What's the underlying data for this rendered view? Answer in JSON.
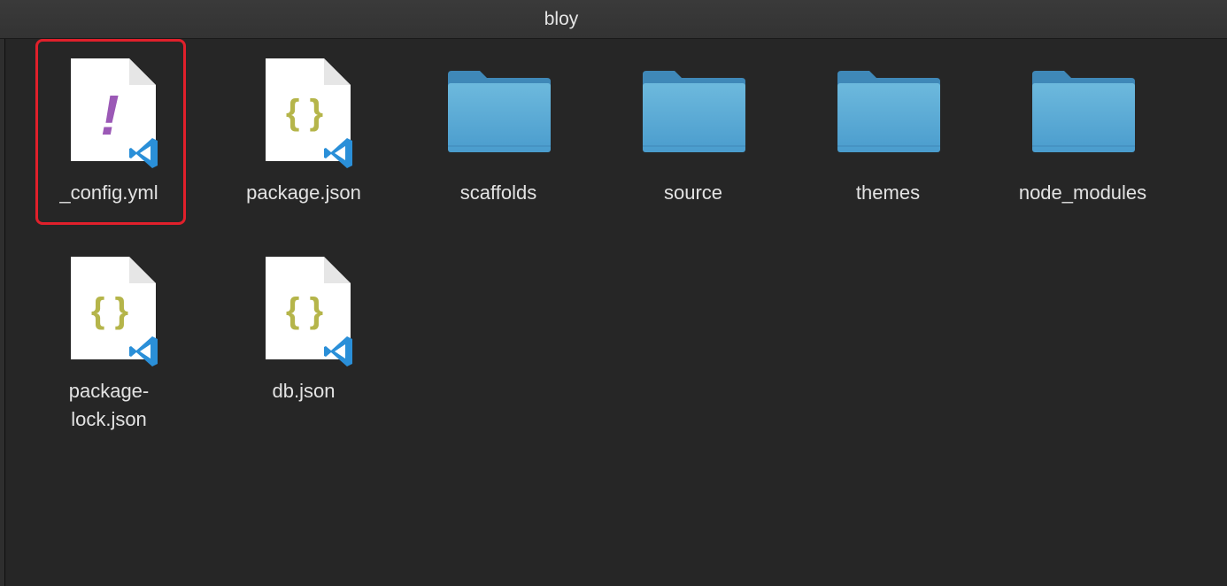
{
  "window": {
    "title": "bloy"
  },
  "items": [
    {
      "name": "_config.yml",
      "kind": "file",
      "glyph": "!",
      "glyph_color": "#9b59b6",
      "badge": "vscode-icon",
      "selected": true
    },
    {
      "name": "package.json",
      "kind": "file",
      "glyph": "{ }",
      "glyph_color": "#b5b54a",
      "badge": "vscode-icon"
    },
    {
      "name": "scaffolds",
      "kind": "folder"
    },
    {
      "name": "source",
      "kind": "folder"
    },
    {
      "name": "themes",
      "kind": "folder"
    },
    {
      "name": "node_modules",
      "kind": "folder"
    },
    {
      "name_line1": "package-",
      "name_line2": "lock.json",
      "kind": "file",
      "glyph": "{ }",
      "glyph_color": "#b5b54a",
      "badge": "vscode-icon"
    },
    {
      "name": "db.json",
      "kind": "file",
      "glyph": "{ }",
      "glyph_color": "#b5b54a",
      "badge": "vscode-icon"
    }
  ],
  "colors": {
    "background": "#262626",
    "folder_top": "#6db9dd",
    "folder_bottom": "#4a9ccd",
    "vscode_blue": "#2a8fd8",
    "selection": "#e0202b"
  }
}
